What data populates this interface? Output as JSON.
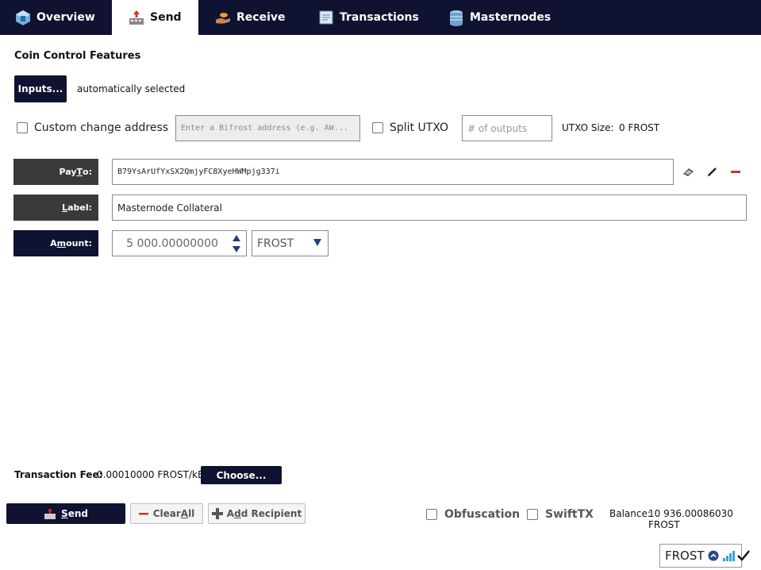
{
  "tabs": [
    {
      "label": "Overview",
      "icon": "overview-icon"
    },
    {
      "label": "Send",
      "icon": "send-icon"
    },
    {
      "label": "Receive",
      "icon": "receive-icon"
    },
    {
      "label": "Transactions",
      "icon": "transactions-icon"
    },
    {
      "label": "Masternodes",
      "icon": "masternodes-icon"
    }
  ],
  "coin_control": {
    "title": "Coin Control Features",
    "inputs_button": "Inputs...",
    "inputs_status": "automatically selected",
    "custom_change_label": "Custom change address",
    "change_address_placeholder": "Enter a Bifrost address (e.g. AW...",
    "split_utxo_label": "Split UTXO",
    "outputs_placeholder": "# of outputs",
    "utxo_size_label": "UTXO Size:",
    "utxo_size_value": "0 FROST"
  },
  "recipient": {
    "pay_to_label_pre": "Pay ",
    "pay_to_label_u": "T",
    "pay_to_label_post": "o:",
    "pay_to_value": "B79YsArUfYxSX2QmjyFC8XyeHWMpjg337i",
    "label_label_u": "L",
    "label_label_post": "abel:",
    "label_value": "Masternode Collateral",
    "amount_label_pre": "A",
    "amount_label_u": "m",
    "amount_label_post": "ount:",
    "amount_value": "5 000.00000000",
    "unit": "FROST"
  },
  "fee": {
    "label": "Transaction Fee:",
    "value": "0.00010000 FROST/kB",
    "choose_button": "Choose..."
  },
  "actions": {
    "send_pre": "",
    "send_u": "S",
    "send_post": "end",
    "clear_pre": "Clear ",
    "clear_u": "A",
    "clear_post": "ll",
    "add_pre": "A",
    "add_u": "d",
    "add_post": "d Recipient",
    "obfuscation_label": "Obfuscation",
    "swifttx_label": "SwiftTX",
    "balance_label": "Balance:",
    "balance_value": "10 936.00086030 FROST"
  },
  "status": {
    "unit": "FROST"
  }
}
